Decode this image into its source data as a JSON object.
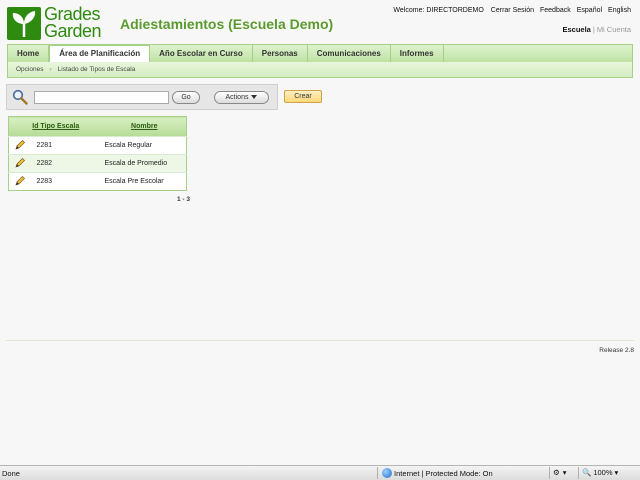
{
  "header": {
    "logo_text_line1": "Grades",
    "logo_text_line2": "Garden",
    "app_title": "Adiestamientos (Escuela Demo)",
    "welcome": "Welcome: DIRECTORDEMO",
    "links": [
      "Cerrar Sesión",
      "Feedback",
      "Español",
      "English"
    ],
    "scope_active": "Escuela",
    "scope_inactive": "Mi Cuenta"
  },
  "nav": {
    "tabs": [
      "Home",
      "Área de Planificación",
      "Año Escolar en Curso",
      "Personas",
      "Comunicaciones",
      "Informes"
    ],
    "active_tab": "Área de Planificación"
  },
  "breadcrumb": [
    "Opciones",
    "Listado de Tipos de Escala"
  ],
  "search": {
    "value": "",
    "go_label": "Go",
    "actions_label": "Actions",
    "create_label": "Crear"
  },
  "table": {
    "columns": [
      "Id Tipo Escala",
      "Nombre"
    ],
    "rows": [
      {
        "id": "2281",
        "name": "Escala Regular"
      },
      {
        "id": "2282",
        "name": "Escala de Promedio"
      },
      {
        "id": "2283",
        "name": "Escala Pre Escolar"
      }
    ],
    "pager": "1 - 3"
  },
  "footer": {
    "release": "Release 2.8"
  },
  "statusbar": {
    "status": "Done",
    "zone": "Internet | Protected Mode: On",
    "zoom": "100%"
  },
  "colors": {
    "brand_green": "#2f8b0f",
    "title_green": "#5b9b2e",
    "nav_green": "#bfe2a3"
  }
}
